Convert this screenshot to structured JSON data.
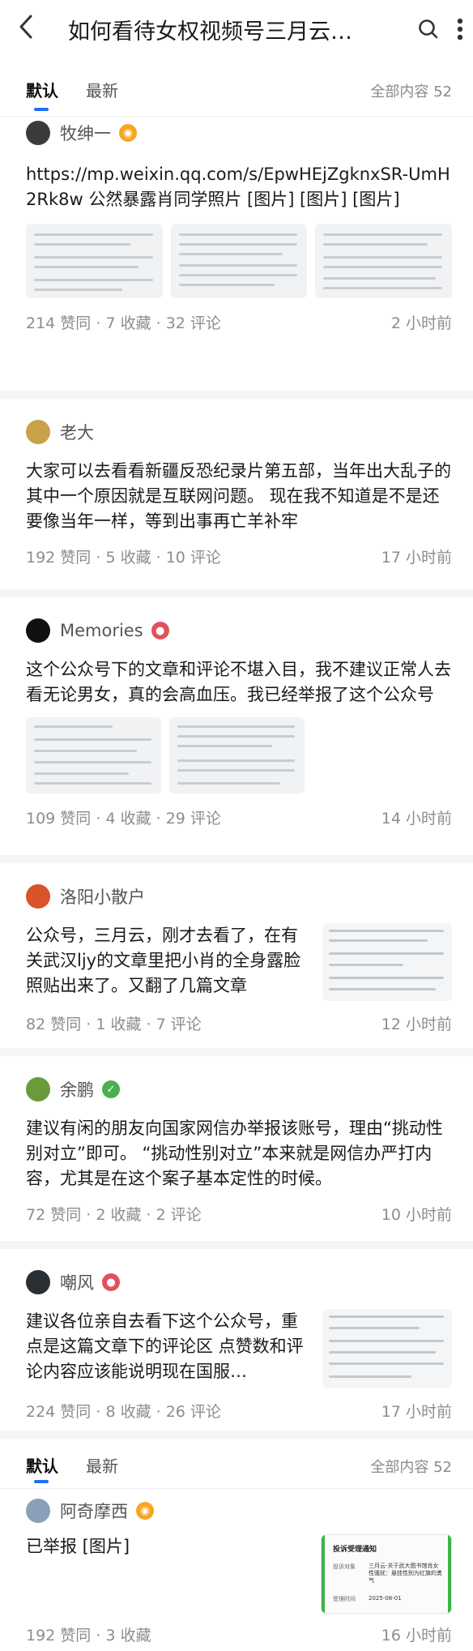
{
  "header": {
    "title": "如何看待女权视频号三月云…",
    "back_icon": "back-chevron-icon",
    "search_icon": "search-icon",
    "more_icon": "more-vertical-icon"
  },
  "tabs": [
    {
      "label": "默认",
      "active": true
    },
    {
      "label": "最新",
      "active": false
    }
  ],
  "total_label": "全部内容 52",
  "posts": [
    {
      "author": "牧绅一",
      "avatar_color": "#3b3b3b",
      "badge_color": "#f5a623",
      "text": "https://mp.weixin.qq.com/s/EpwHEjZgknxSR-UmH2Rk8w 公然暴露肖同学照片 [图片] [图片] [图片]",
      "likes": "214 赞同",
      "collects": "7 收藏",
      "comments": "32 评论",
      "time": "2 小时前"
    },
    {
      "author": "老大",
      "avatar_color": "#c9a24a",
      "text": "大家可以去看看新疆反恐纪录片第五部，当年出大乱子的其中一个原因就是互联网问题。 现在我不知道是不是还要像当年一样，等到出事再亡羊补牢",
      "likes": "192 赞同",
      "collects": "5 收藏",
      "comments": "10 评论",
      "time": "17 小时前"
    },
    {
      "author": "Memories",
      "avatar_color": "#111111",
      "badge_color": "#e0525c",
      "text": "这个公众号下的文章和评论不堪入目，我不建议正常人去看无论男女，真的会高血压。我已经举报了这个公众号",
      "likes": "109 赞同",
      "collects": "4 收藏",
      "comments": "29 评论",
      "time": "14 小时前"
    },
    {
      "author": "洛阳小散户",
      "avatar_color": "#d9532b",
      "text": "公众号，三月云，刚才去看了，在有关武汉ljy的文章里把小肖的全身露脸照贴出来了。又翻了几篇文章",
      "likes": "82 赞同",
      "collects": "1 收藏",
      "comments": "7 评论",
      "time": "12 小时前"
    },
    {
      "author": "余鹏",
      "avatar_color": "#6a9b3a",
      "badge_color": "#4cb050",
      "text": "建议有闲的朋友向国家网信办举报该账号，理由“挑动性别对立”即可。 “挑动性别对立”本来就是网信办严打内容，尤其是在这个案子基本定性的时候。",
      "likes": "72 赞同",
      "collects": "2 收藏",
      "comments": "2 评论",
      "time": "10 小时前"
    },
    {
      "author": "嘲风",
      "avatar_color": "#2a2f33",
      "badge_color": "#e0525c",
      "text": "建议各位亲自去看下这个公众号，重点是这篇文章下的评论区 点赞数和评论内容应该能说明现在国服…",
      "likes": "224 赞同",
      "collects": "8 收藏",
      "comments": "26 评论",
      "time": "17 小时前"
    },
    {
      "author": "阿奇摩西",
      "avatar_color": "#8aa0b8",
      "badge_color": "#f5a623",
      "text": "已举报 [图片]",
      "likes": "192 赞同",
      "collects": "3 收藏",
      "time": "16 小时前",
      "image_title": "投诉受理通知",
      "image_row1_label": "投诉对象",
      "image_row1_value": "三月云-关于武大图书馆肖女性骚扰：悬挂性别为红旗的勇气",
      "image_row2_label": "受理时间",
      "image_row2_value": "2025-08-01"
    }
  ]
}
